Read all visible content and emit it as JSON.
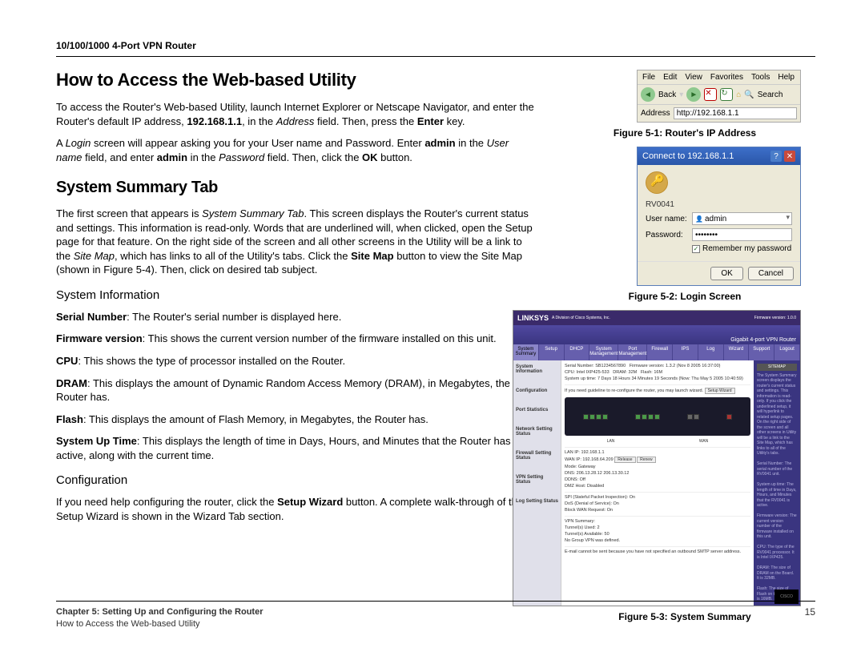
{
  "header": {
    "product": "10/100/1000 4-Port VPN Router"
  },
  "h_access": "How to Access the Web-based Utility",
  "p_access_1a": "To access the Router's Web-based Utility, launch Internet Explorer or Netscape Navigator, and enter the Router's default IP address, ",
  "p_access_1b": "192.168.1.1",
  "p_access_1c": ", in the ",
  "p_access_1d": "Address",
  "p_access_1e": " field. Then, press the ",
  "p_access_1f": "Enter",
  "p_access_1g": " key.",
  "p_access_2a": "A ",
  "p_access_2b": "Login",
  "p_access_2c": " screen will appear asking you for your User name and Password. Enter ",
  "p_access_2d": "admin",
  "p_access_2e": " in the ",
  "p_access_2f": "User name",
  "p_access_2g": " field, and enter ",
  "p_access_2h": "admin",
  "p_access_2i": " in the ",
  "p_access_2j": "Password",
  "p_access_2k": " field.   Then, click the ",
  "p_access_2l": "OK",
  "p_access_2m": " button.",
  "h_summary": "System Summary Tab",
  "p_summary_a": "The first screen that appears is ",
  "p_summary_b": "System Summary Tab",
  "p_summary_c": ". This screen displays the Router's current status and settings. This information is read-only. Words that are underlined will, when clicked, open the Setup page for that feature. On the right side of the screen and all other screens in the Utility will be a link to the ",
  "p_summary_d": "Site Map",
  "p_summary_e": ", which has links to all of the Utility's tabs. Click the ",
  "p_summary_f": "Site Map",
  "p_summary_g": " button to view the Site Map (shown in Figure 5-4). Then, click on desired tab subject.",
  "h_sysinfo": "System Information",
  "si_serial_l": "Serial Number",
  "si_serial_t": ": The Router's serial number is displayed here.",
  "si_fw_l": "Firmware version",
  "si_fw_t": ": This shows the current version number of the firmware installed on this unit.",
  "si_cpu_l": "CPU",
  "si_cpu_t": ": This shows the type of processor installed on the Router.",
  "si_dram_l": "DRAM",
  "si_dram_t": ": This displays the amount of Dynamic Random Access Memory (DRAM), in Megabytes, the Router has.",
  "si_flash_l": "Flash",
  "si_flash_t": ": This displays the amount of Flash Memory, in Megabytes, the Router has.",
  "si_up_l": "System Up Time",
  "si_up_t": ": This displays the length of time in Days, Hours, and Minutes that the Router has been active, along with the current time.",
  "h_config": "Configuration",
  "p_config_a": "If you need help configuring the router, click the ",
  "p_config_b": "Setup Wizard",
  "p_config_c": " button. A complete walk-through of the Setup Wizard is shown in the Wizard Tab section.",
  "fig1_caption": "Figure 5-1: Router's IP Address",
  "fig2_caption": "Figure 5-2: Login Screen",
  "fig3_caption": "Figure 5-3: System Summary",
  "browser": {
    "menu": [
      "File",
      "Edit",
      "View",
      "Favorites",
      "Tools",
      "Help"
    ],
    "back": "Back",
    "search": "Search",
    "addr_label": "Address",
    "addr_value": "http://192.168.1.1"
  },
  "login": {
    "title": "Connect to 192.168.1.1",
    "realm": "RV0041",
    "user_label": "User name:",
    "user_value": "admin",
    "pass_label": "Password:",
    "pass_value": "••••••••",
    "remember": "Remember my password",
    "ok": "OK",
    "cancel": "Cancel"
  },
  "ss": {
    "brand": "LINKSYS",
    "subbrand": "A Division of Cisco Systems, Inc.",
    "model": "Gigabit 4-port VPN Router",
    "fw_tag": "Firmware version: 1.0.0",
    "tabs": [
      "System Summary",
      "Setup",
      "DHCP",
      "System Management",
      "Port Management",
      "Firewall",
      "IPS",
      "Log",
      "Wizard",
      "Support",
      "Logout"
    ],
    "left_labels": [
      "System Information",
      "Configuration",
      "Port Statistics",
      "Network Setting Status",
      "Firewall Setting Status",
      "VPN Setting Status",
      "Log Setting Status"
    ],
    "info": {
      "serial_l": "Serial Number:",
      "serial_v": "SB1234567890",
      "fw_l": "Firmware version:",
      "fw_v": "1.3.2 (Nov 8 2005 16:37:00)",
      "cpu_l": "CPU:",
      "cpu_v": "Intel IXP425-533",
      "dram_l": "DRAM:",
      "dram_v": "32M",
      "flash_l": "Flash:",
      "flash_v": "16M",
      "up_l": "System up time:",
      "up_v": "7 Days 18 Hours 34 Minutes 19 Seconds   (Now: Thu May 5 2005 10:40:59)"
    },
    "config_text": "If you need guideline to re-configure the router, you may launch wizard.",
    "config_btn": "Setup Wizard",
    "ports_lan": "LAN",
    "ports_wan": "WAN",
    "net": {
      "lanip_l": "LAN IP:",
      "lanip_v": "192.168.1.1",
      "wanip_l": "WAN IP:",
      "wanip_v": "192.168.64.209",
      "mode_l": "Mode:",
      "mode_v": "Gateway",
      "dns_l": "DNS:",
      "dns_v": "206.13.28.12   206.13.30.12",
      "ddns_l": "DDNS:",
      "ddns_v": "Off",
      "dmz_l": "DMZ Host:",
      "dmz_v": "Disabled",
      "release_btn": "Release",
      "renew_btn": "Renew"
    },
    "fw": {
      "spi_l": "SPI (Stateful Packet Inspection):",
      "spi_v": "On",
      "dos_l": "DoS (Denial of Service):",
      "dos_v": "On",
      "wan_l": "Block WAN Request:",
      "wan_v": "On"
    },
    "vpn": {
      "t_l": "VPN Summary:",
      "tu_l": "Tunnel(s) Used:",
      "tu_v": "2",
      "ta_l": "Tunnel(s) Available:",
      "ta_v": "50",
      "ng_l": "No Group VPN was defined."
    },
    "log": "E-mail cannot be sent because you have not specified an outbound SMTP server address.",
    "sitemap_btn": "Site Map",
    "right_title": "SITEMAP",
    "right_text": "The System Summary screen displays the router's current status and settings. This information is read-only. If you click the underlined setup, it will hyperlink to related setup pages. On the right side of the screen and all other screens in Utility will be a link to the Site Map, which has links to all of the Utility's tabs.\n\nSerial Number: The serial number of the RV0041 unit.\n\nSystem up time: The length of time in Days, Hours, and Minutes that the RV0041 is active.\n\nFirmware version: The current version number of the firmware installed on this unit.\n\nCPU: The type of the RV0041 processor. It is Intel IXP425.\n\nDRAM: The size of DRAM on the Board. It is 32MB.\n\nFlash: The size of Flash on the Board. It is 16MB.\n\nConfiguration: If you need guideline to re-configure the router, you may launch Wizard.\n\nMore..."
  },
  "footer": {
    "chapter": "Chapter 5: Setting Up and Configuring the Router",
    "section": "How to Access the Web-based Utility",
    "page": "15"
  }
}
